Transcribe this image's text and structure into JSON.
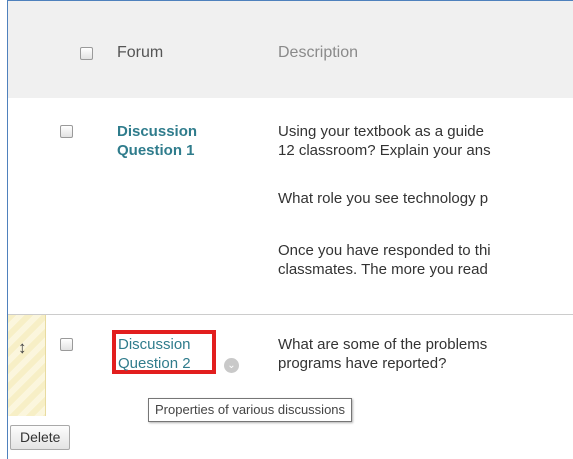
{
  "header": {
    "forum_label": "Forum",
    "description_label": "Description"
  },
  "rows": [
    {
      "forum_line1": "Discussion",
      "forum_line2": "Question 1",
      "description": [
        "Using your textbook as a guide",
        "12 classroom? Explain your ans",
        "What role you see technology p",
        "Once you have responded to thi",
        "classmates. The more you read"
      ]
    },
    {
      "forum_line1": "Discussion",
      "forum_line2": "Question 2",
      "description": [
        "What are some of the problems",
        "programs have reported?"
      ]
    }
  ],
  "drag_handle_glyph": "↕",
  "chevron_glyph": "⌄",
  "tooltip": "Properties of various discussions",
  "delete_label": "Delete",
  "colors": {
    "link": "#2f7c8c",
    "highlight_border": "#e21e1e",
    "frame_border": "#4f81bd",
    "header_bg": "#f0f0f0",
    "drag_strip": "#f7efc6"
  }
}
